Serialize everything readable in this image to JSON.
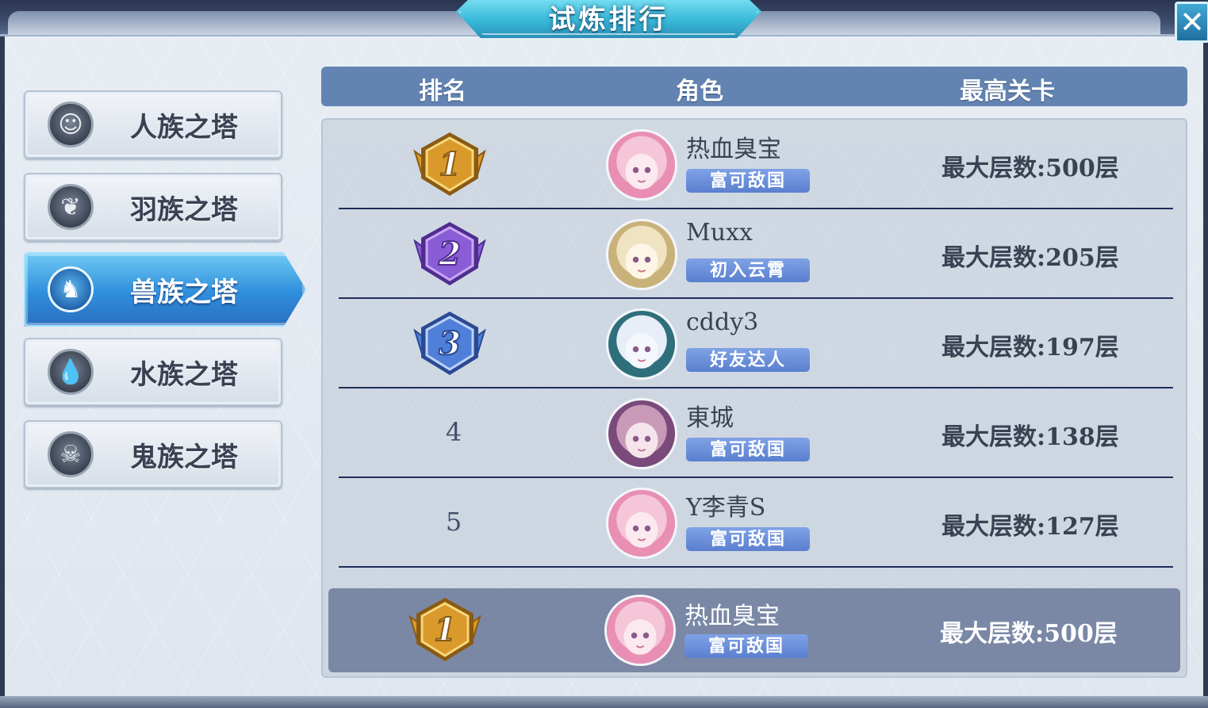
{
  "window": {
    "title": "试炼排行",
    "close_label": "✕"
  },
  "sidebar": {
    "items": [
      {
        "label": "人族之塔",
        "icon": "human-face-icon",
        "glyph": "☺",
        "active": false
      },
      {
        "label": "羽族之塔",
        "icon": "feather-wing-icon",
        "glyph": "❦",
        "active": false
      },
      {
        "label": "兽族之塔",
        "icon": "wolf-head-icon",
        "glyph": "♞",
        "active": true
      },
      {
        "label": "水族之塔",
        "icon": "water-drop-icon",
        "glyph": "💧",
        "active": false
      },
      {
        "label": "鬼族之塔",
        "icon": "skull-icon",
        "glyph": "☠",
        "active": false
      }
    ]
  },
  "table": {
    "headers": {
      "rank": "排名",
      "role": "角色",
      "best": "最高关卡"
    },
    "rows": [
      {
        "rank": "1",
        "badge": "gold",
        "name": "热血臭宝",
        "title": "富可敌国",
        "floor": "最大层数:500层",
        "avatar": "pink"
      },
      {
        "rank": "2",
        "badge": "purple",
        "name": "Muxx",
        "title": "初入云霄",
        "floor": "最大层数:205层",
        "avatar": "blonde"
      },
      {
        "rank": "3",
        "badge": "blue",
        "name": "cddy3",
        "title": "好友达人",
        "floor": "最大层数:197层",
        "avatar": "white"
      },
      {
        "rank": "4",
        "badge": "",
        "name": "東城",
        "title": "富可敌国",
        "floor": "最大层数:138层",
        "avatar": "mauve"
      },
      {
        "rank": "5",
        "badge": "",
        "name": "Y李青S",
        "title": "富可敌国",
        "floor": "最大层数:127层",
        "avatar": "pink"
      }
    ],
    "mine": {
      "rank": "1",
      "badge": "gold",
      "name": "热血臭宝",
      "title": "富可敌国",
      "floor": "最大层数:500层",
      "avatar": "pink"
    }
  },
  "colors": {
    "header_bg": "#6384b2",
    "active_tab": "#2f8fdc",
    "title_badge": "#5a7fcf",
    "badge_gold": "#e3a83a",
    "badge_purple": "#8a5cd6",
    "badge_blue": "#4f7fd8"
  }
}
